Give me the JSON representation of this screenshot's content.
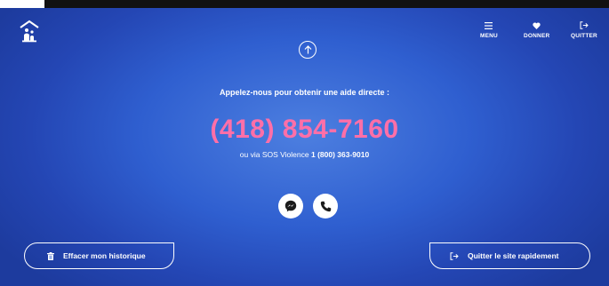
{
  "nav": {
    "menu_label": "MENU",
    "donate_label": "DONNER",
    "quit_label": "QUITTER"
  },
  "main": {
    "call_text": "Appelez-nous pour obtenir une aide directe :",
    "phone": "(418) 854-7160",
    "sos_prefix": "ou via SOS Violence",
    "sos_number": "1 (800) 363-9010"
  },
  "buttons": {
    "clear_history": "Effacer mon historique",
    "quit_fast": "Quitter le site rapidement"
  },
  "icons": {
    "logo": "house-figure-logo",
    "menu": "hamburger-icon",
    "donate": "heart-icon",
    "quit": "exit-arrow-icon",
    "scroll_up": "arrow-up-icon",
    "messenger": "messenger-icon",
    "phone": "phone-icon",
    "trash": "trash-icon",
    "exit": "exit-arrow-icon"
  },
  "colors": {
    "background": "#2f5fd0",
    "phone": "#ff6fa8",
    "text": "#ffffff"
  }
}
